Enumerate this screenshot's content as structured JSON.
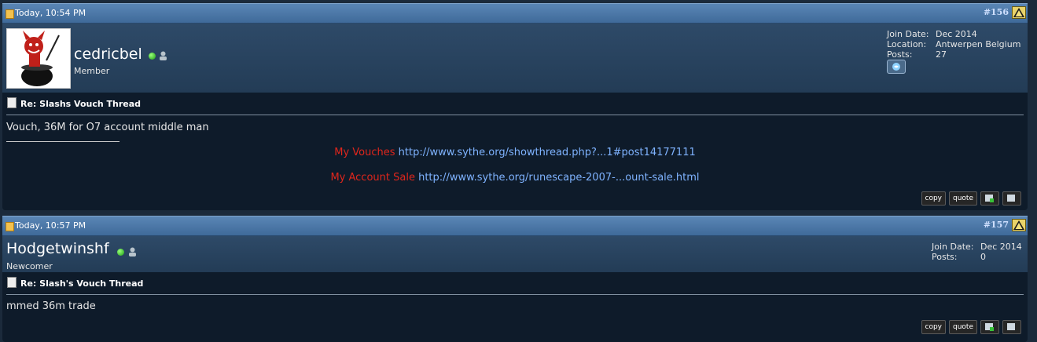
{
  "posts": [
    {
      "date": "Today, 10:54 PM",
      "number": "#156",
      "username": "cedricbel",
      "user_title": "Member",
      "stats": [
        {
          "label": "Join Date:",
          "value": "Dec 2014"
        },
        {
          "label": "Location:",
          "value": "Antwerpen Belgium"
        },
        {
          "label": "Posts:",
          "value": "27"
        }
      ],
      "title": "Re: Slashs Vouch Thread",
      "message": "Vouch, 36M for O7 account middle man",
      "signature": [
        {
          "label": "My Vouches",
          "link": "http://www.sythe.org/showthread.php?...1#post14177111"
        },
        {
          "label": "My Account Sale",
          "link": "http://www.sythe.org/runescape-2007-...ount-sale.html"
        }
      ]
    },
    {
      "date": "Today, 10:57 PM",
      "number": "#157",
      "username": "Hodgetwinshf",
      "user_title": "Newcomer",
      "stats": [
        {
          "label": "Join Date:",
          "value": "Dec 2014"
        },
        {
          "label": "Posts:",
          "value": "0"
        }
      ],
      "title": "Re: Slash's Vouch Thread",
      "message": "mmed 36m trade"
    }
  ],
  "buttons": {
    "copy": "copy",
    "quote": "quote"
  },
  "icons": {
    "post_date": "doc-icon",
    "report": "warning-icon",
    "online": "online-dot-icon",
    "profile": "user-icon",
    "skype": "skype-icon",
    "post_title": "page-icon",
    "multiquote": "multiquote-icon",
    "edit": "edit-icon"
  }
}
